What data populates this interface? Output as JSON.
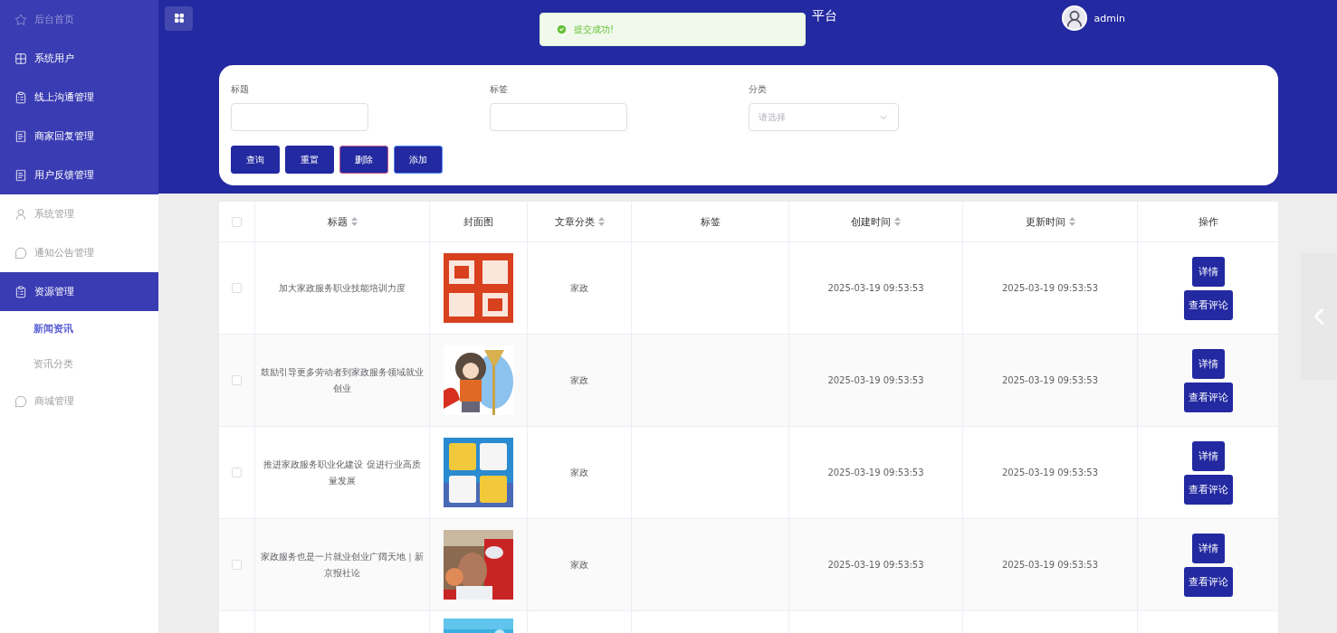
{
  "sidebar": {
    "top_menu": [
      {
        "label": "后台首页",
        "dimmed": true
      },
      {
        "label": "系统用户",
        "dimmed": false
      },
      {
        "label": "线上沟通管理",
        "dimmed": false
      },
      {
        "label": "商家回复管理",
        "dimmed": false
      },
      {
        "label": "用户反馈管理",
        "dimmed": false
      }
    ],
    "items": [
      {
        "label": "系统管理",
        "selected": false
      },
      {
        "label": "通知公告管理",
        "selected": false
      },
      {
        "label": "资源管理",
        "selected": true,
        "children": [
          {
            "label": "新闻资讯",
            "selected": true
          },
          {
            "label": "资讯分类",
            "selected": false
          }
        ]
      },
      {
        "label": "商城管理",
        "selected": false
      }
    ]
  },
  "header": {
    "title": "平台",
    "user": "admin"
  },
  "toast": {
    "message": "提交成功!"
  },
  "filters": [
    {
      "label": "标题",
      "kind": "text"
    },
    {
      "label": "标签",
      "kind": "text"
    },
    {
      "label": "分类",
      "kind": "select",
      "placeholder": "请选择"
    }
  ],
  "actions": [
    {
      "label": "查询",
      "hovered": false,
      "kind": "normal"
    },
    {
      "label": "重置",
      "hovered": false,
      "kind": "normal"
    },
    {
      "label": "删除",
      "hovered": false,
      "kind": "danger"
    },
    {
      "label": "添加",
      "hovered": true,
      "kind": "normal"
    }
  ],
  "table": {
    "select_all": {
      "checked": false
    },
    "columns": [
      {
        "label": "标题",
        "sortable": true
      },
      {
        "label": "封面图",
        "sortable": false
      },
      {
        "label": "文章分类",
        "sortable": true
      },
      {
        "label": "标签",
        "sortable": false
      },
      {
        "label": "创建时间",
        "sortable": true
      },
      {
        "label": "更新时间",
        "sortable": true
      },
      {
        "label": "操作",
        "sortable": false
      }
    ],
    "rows": [
      {
        "checked": false,
        "title": "加大家政服务职业技能培训力度",
        "cover": {
          "kind": "picture"
        },
        "category": "家政",
        "created": "2025-03-19 09:53:53",
        "updated": "2025-03-19 09:53:53",
        "buttons": [
          "详情",
          "查看评论"
        ]
      },
      {
        "checked": false,
        "title": "鼓励引导更多劳动者到家政服务领域就业创业",
        "cover": {
          "kind": "picture"
        },
        "category": "家政",
        "created": "2025-03-19 09:53:53",
        "updated": "2025-03-19 09:53:53",
        "buttons": [
          "详情",
          "查看评论"
        ]
      },
      {
        "checked": false,
        "title": "推进家政服务职业化建设 促进行业高质量发展",
        "cover": {
          "kind": "picture"
        },
        "category": "家政",
        "created": "2025-03-19 09:53:53",
        "updated": "2025-03-19 09:53:53",
        "buttons": [
          "详情",
          "查看评论"
        ]
      },
      {
        "checked": false,
        "title": "家政服务也是一片就业创业广阔天地｜新京报社论",
        "cover": {
          "kind": "picture"
        },
        "category": "家政",
        "created": "2025-03-19 09:53:53",
        "updated": "2025-03-19 09:53:53",
        "buttons": [
          "详情",
          "查看评论"
        ]
      }
    ]
  }
}
